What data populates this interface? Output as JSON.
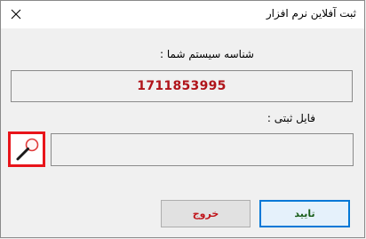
{
  "window": {
    "title": "ثبت آفلاین نرم افزار",
    "close_icon": "close-icon"
  },
  "system_id": {
    "label": "شناسه سیستم شما :",
    "value": "1711853995"
  },
  "file": {
    "label": "فایل ثبتی :",
    "value": "",
    "browse_icon": "magnifier-icon"
  },
  "buttons": {
    "exit_label": "خروج",
    "ok_label": "تایید"
  },
  "colors": {
    "id_text": "#b0141a",
    "browse_border": "#e8141a",
    "ok_border": "#0078d7",
    "ok_text": "#1a5e1a",
    "exit_text": "#c0141a"
  }
}
